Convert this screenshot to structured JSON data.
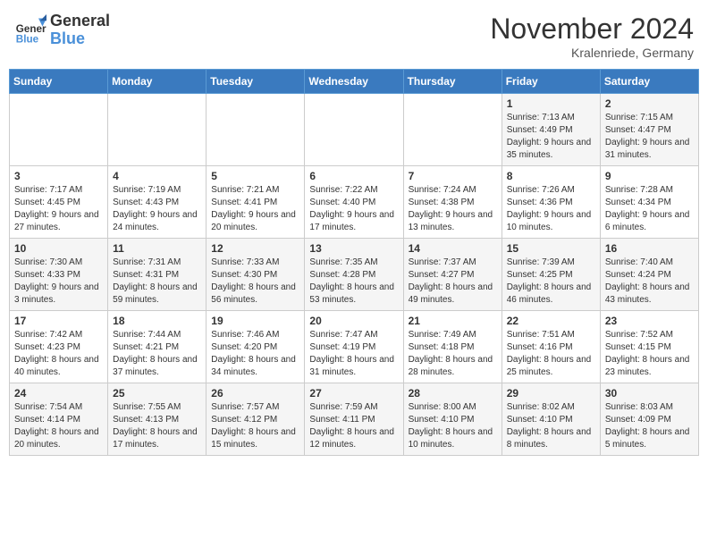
{
  "header": {
    "logo_general": "General",
    "logo_blue": "Blue",
    "month_title": "November 2024",
    "location": "Kralenriede, Germany"
  },
  "days_of_week": [
    "Sunday",
    "Monday",
    "Tuesday",
    "Wednesday",
    "Thursday",
    "Friday",
    "Saturday"
  ],
  "weeks": [
    [
      {
        "day": "",
        "info": ""
      },
      {
        "day": "",
        "info": ""
      },
      {
        "day": "",
        "info": ""
      },
      {
        "day": "",
        "info": ""
      },
      {
        "day": "",
        "info": ""
      },
      {
        "day": "1",
        "info": "Sunrise: 7:13 AM\nSunset: 4:49 PM\nDaylight: 9 hours and 35 minutes."
      },
      {
        "day": "2",
        "info": "Sunrise: 7:15 AM\nSunset: 4:47 PM\nDaylight: 9 hours and 31 minutes."
      }
    ],
    [
      {
        "day": "3",
        "info": "Sunrise: 7:17 AM\nSunset: 4:45 PM\nDaylight: 9 hours and 27 minutes."
      },
      {
        "day": "4",
        "info": "Sunrise: 7:19 AM\nSunset: 4:43 PM\nDaylight: 9 hours and 24 minutes."
      },
      {
        "day": "5",
        "info": "Sunrise: 7:21 AM\nSunset: 4:41 PM\nDaylight: 9 hours and 20 minutes."
      },
      {
        "day": "6",
        "info": "Sunrise: 7:22 AM\nSunset: 4:40 PM\nDaylight: 9 hours and 17 minutes."
      },
      {
        "day": "7",
        "info": "Sunrise: 7:24 AM\nSunset: 4:38 PM\nDaylight: 9 hours and 13 minutes."
      },
      {
        "day": "8",
        "info": "Sunrise: 7:26 AM\nSunset: 4:36 PM\nDaylight: 9 hours and 10 minutes."
      },
      {
        "day": "9",
        "info": "Sunrise: 7:28 AM\nSunset: 4:34 PM\nDaylight: 9 hours and 6 minutes."
      }
    ],
    [
      {
        "day": "10",
        "info": "Sunrise: 7:30 AM\nSunset: 4:33 PM\nDaylight: 9 hours and 3 minutes."
      },
      {
        "day": "11",
        "info": "Sunrise: 7:31 AM\nSunset: 4:31 PM\nDaylight: 8 hours and 59 minutes."
      },
      {
        "day": "12",
        "info": "Sunrise: 7:33 AM\nSunset: 4:30 PM\nDaylight: 8 hours and 56 minutes."
      },
      {
        "day": "13",
        "info": "Sunrise: 7:35 AM\nSunset: 4:28 PM\nDaylight: 8 hours and 53 minutes."
      },
      {
        "day": "14",
        "info": "Sunrise: 7:37 AM\nSunset: 4:27 PM\nDaylight: 8 hours and 49 minutes."
      },
      {
        "day": "15",
        "info": "Sunrise: 7:39 AM\nSunset: 4:25 PM\nDaylight: 8 hours and 46 minutes."
      },
      {
        "day": "16",
        "info": "Sunrise: 7:40 AM\nSunset: 4:24 PM\nDaylight: 8 hours and 43 minutes."
      }
    ],
    [
      {
        "day": "17",
        "info": "Sunrise: 7:42 AM\nSunset: 4:23 PM\nDaylight: 8 hours and 40 minutes."
      },
      {
        "day": "18",
        "info": "Sunrise: 7:44 AM\nSunset: 4:21 PM\nDaylight: 8 hours and 37 minutes."
      },
      {
        "day": "19",
        "info": "Sunrise: 7:46 AM\nSunset: 4:20 PM\nDaylight: 8 hours and 34 minutes."
      },
      {
        "day": "20",
        "info": "Sunrise: 7:47 AM\nSunset: 4:19 PM\nDaylight: 8 hours and 31 minutes."
      },
      {
        "day": "21",
        "info": "Sunrise: 7:49 AM\nSunset: 4:18 PM\nDaylight: 8 hours and 28 minutes."
      },
      {
        "day": "22",
        "info": "Sunrise: 7:51 AM\nSunset: 4:16 PM\nDaylight: 8 hours and 25 minutes."
      },
      {
        "day": "23",
        "info": "Sunrise: 7:52 AM\nSunset: 4:15 PM\nDaylight: 8 hours and 23 minutes."
      }
    ],
    [
      {
        "day": "24",
        "info": "Sunrise: 7:54 AM\nSunset: 4:14 PM\nDaylight: 8 hours and 20 minutes."
      },
      {
        "day": "25",
        "info": "Sunrise: 7:55 AM\nSunset: 4:13 PM\nDaylight: 8 hours and 17 minutes."
      },
      {
        "day": "26",
        "info": "Sunrise: 7:57 AM\nSunset: 4:12 PM\nDaylight: 8 hours and 15 minutes."
      },
      {
        "day": "27",
        "info": "Sunrise: 7:59 AM\nSunset: 4:11 PM\nDaylight: 8 hours and 12 minutes."
      },
      {
        "day": "28",
        "info": "Sunrise: 8:00 AM\nSunset: 4:10 PM\nDaylight: 8 hours and 10 minutes."
      },
      {
        "day": "29",
        "info": "Sunrise: 8:02 AM\nSunset: 4:10 PM\nDaylight: 8 hours and 8 minutes."
      },
      {
        "day": "30",
        "info": "Sunrise: 8:03 AM\nSunset: 4:09 PM\nDaylight: 8 hours and 5 minutes."
      }
    ]
  ]
}
